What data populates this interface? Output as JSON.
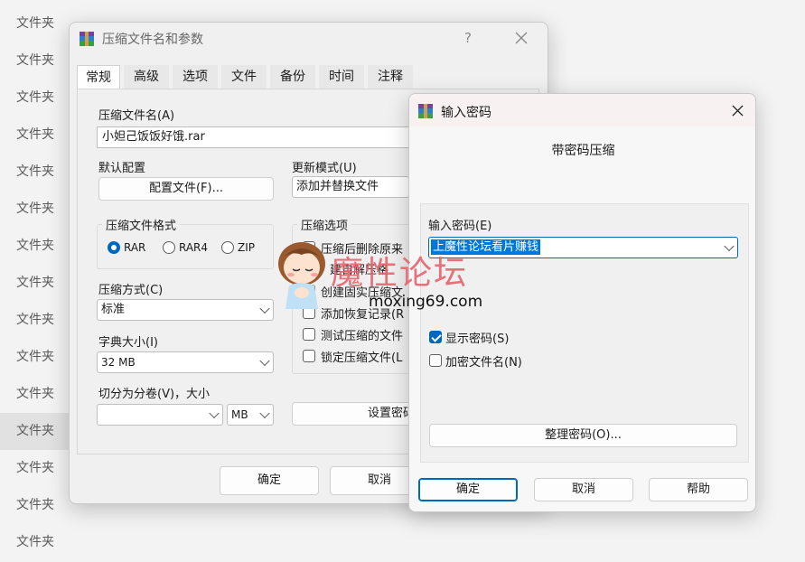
{
  "background": {
    "items": [
      "文件夹",
      "文件夹",
      "文件夹",
      "文件夹",
      "文件夹",
      "文件夹",
      "文件夹",
      "文件夹",
      "文件夹",
      "文件夹",
      "文件夹",
      "文件夹",
      "文件夹",
      "文件夹",
      "文件夹"
    ],
    "selected_index": 11
  },
  "main_dialog": {
    "title": "压缩文件名和参数",
    "help": "?",
    "tabs": [
      "常规",
      "高级",
      "选项",
      "文件",
      "备份",
      "时间",
      "注释"
    ],
    "archive_name_label": "压缩文件名(A)",
    "archive_name_value": "小妲己饭饭好饿.rar",
    "default_profile_label": "默认配置",
    "profile_button": "配置文件(F)...",
    "update_mode_label": "更新模式(U)",
    "update_mode_value": "添加并替换文件",
    "format_group_title": "压缩文件格式",
    "formats": [
      "RAR",
      "RAR4",
      "ZIP"
    ],
    "options_group_title": "压缩选项",
    "options": [
      "压缩后删除原来",
      "建自解压格",
      "创建固实压缩文",
      "添加恢复记录(R",
      "测试压缩的文件",
      "锁定压缩文件(L"
    ],
    "method_label": "压缩方式(C)",
    "method_value": "标准",
    "dict_label": "字典大小(I)",
    "dict_value": "32 MB",
    "split_label": "切分为分卷(V)，大小",
    "split_unit": "MB",
    "set_password_button": "设置密码",
    "ok_button": "确定",
    "cancel_button": "取消"
  },
  "password_dialog": {
    "title": "输入密码",
    "heading": "带密码压缩",
    "password_label": "输入密码(E)",
    "password_value": "上魔性论坛看片赚钱",
    "show_password_label": "显示密码(S)",
    "encrypt_names_label": "加密文件名(N)",
    "organize_button": "整理密码(O)...",
    "ok_button": "确定",
    "cancel_button": "取消",
    "help_button": "帮助"
  },
  "watermark": {
    "title": "魔性论坛",
    "url": "moxing69.com"
  },
  "colors": {
    "accent": "#0067c0",
    "watermark": "#e5646f",
    "selection": "#0078d7"
  }
}
